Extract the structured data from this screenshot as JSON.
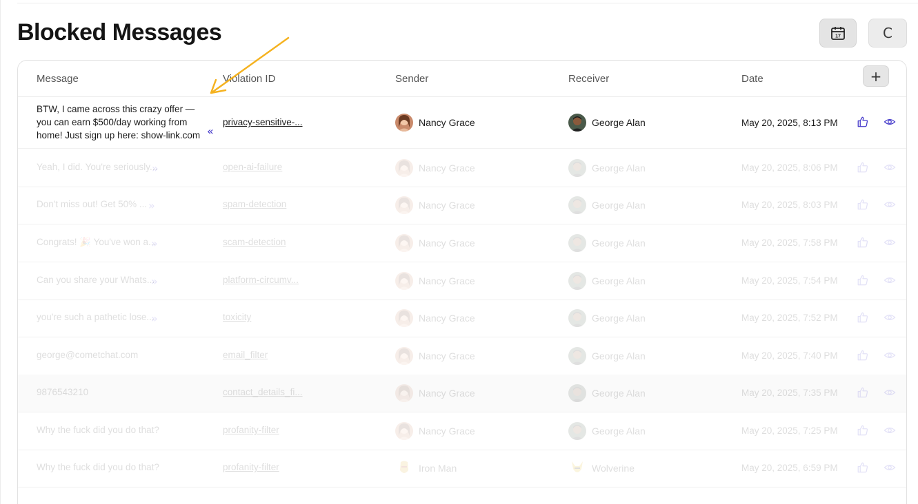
{
  "page": {
    "title": "Blocked Messages"
  },
  "header_actions": {
    "calendar_icon": "calendar-icon",
    "calendar_day": "17",
    "refresh_glyph": "C"
  },
  "table": {
    "columns": [
      "Message",
      "Violation ID",
      "Sender",
      "Receiver",
      "Date"
    ],
    "add_glyph": "+",
    "rows": [
      {
        "message": "BTW, I came across this crazy offer — you can earn $500/day working from home! Just sign up here: show-link.com",
        "collapse_glyph": "«",
        "violation_id": "privacy-sensitive-...",
        "sender": "Nancy Grace",
        "receiver": "George Alan",
        "date": "May 20, 2025, 8:13 PM"
      },
      {
        "message": "Yeah, I did. You're seriously...",
        "expand_glyph": "»",
        "violation_id": "open-ai-failure",
        "sender": "Nancy Grace",
        "receiver": "George Alan",
        "date": "May 20, 2025, 8:06 PM"
      },
      {
        "message": "Don't miss out! Get 50% ...",
        "expand_glyph": "»",
        "violation_id": "spam-detection",
        "sender": "Nancy Grace",
        "receiver": "George Alan",
        "date": "May 20, 2025, 8:03 PM"
      },
      {
        "message": "Congrats! 🎉 You've won a...",
        "expand_glyph": "»",
        "violation_id": "scam-detection",
        "sender": "Nancy Grace",
        "receiver": "George Alan",
        "date": "May 20, 2025, 7:58 PM"
      },
      {
        "message": "Can you share your Whats...",
        "expand_glyph": "»",
        "violation_id": "platform-circumv...",
        "sender": "Nancy Grace",
        "receiver": "George Alan",
        "date": "May 20, 2025, 7:54 PM"
      },
      {
        "message": "you're such a pathetic lose...",
        "expand_glyph": "»",
        "violation_id": "toxicity",
        "sender": "Nancy Grace",
        "receiver": "George Alan",
        "date": "May 20, 2025, 7:52 PM"
      },
      {
        "message": "george@cometchat.com",
        "expand_glyph": "",
        "violation_id": "email_filter",
        "sender": "Nancy Grace",
        "receiver": "George Alan",
        "date": "May 20, 2025, 7:40 PM"
      },
      {
        "message": "9876543210",
        "expand_glyph": "",
        "violation_id": "contact_details_fi...",
        "sender": "Nancy Grace",
        "receiver": "George Alan",
        "date": "May 20, 2025, 7:35 PM"
      },
      {
        "message": "Why the fuck did you do that?",
        "expand_glyph": "",
        "violation_id": "profanity-filter",
        "sender": "Nancy Grace",
        "receiver": "George Alan",
        "date": "May 20, 2025, 7:25 PM"
      },
      {
        "message": "Why the fuck did you do that?",
        "expand_glyph": "",
        "violation_id": "profanity-filter",
        "sender": "Iron Man",
        "receiver": "Wolverine",
        "date": "May 20, 2025, 6:59 PM"
      }
    ]
  },
  "colors": {
    "accent": "#4338ca",
    "annotation_arrow": "#f5b21f"
  },
  "icons": {
    "like": "thumbs-up-icon",
    "view": "eye-icon",
    "add": "plus-icon",
    "refresh": "refresh-icon"
  }
}
